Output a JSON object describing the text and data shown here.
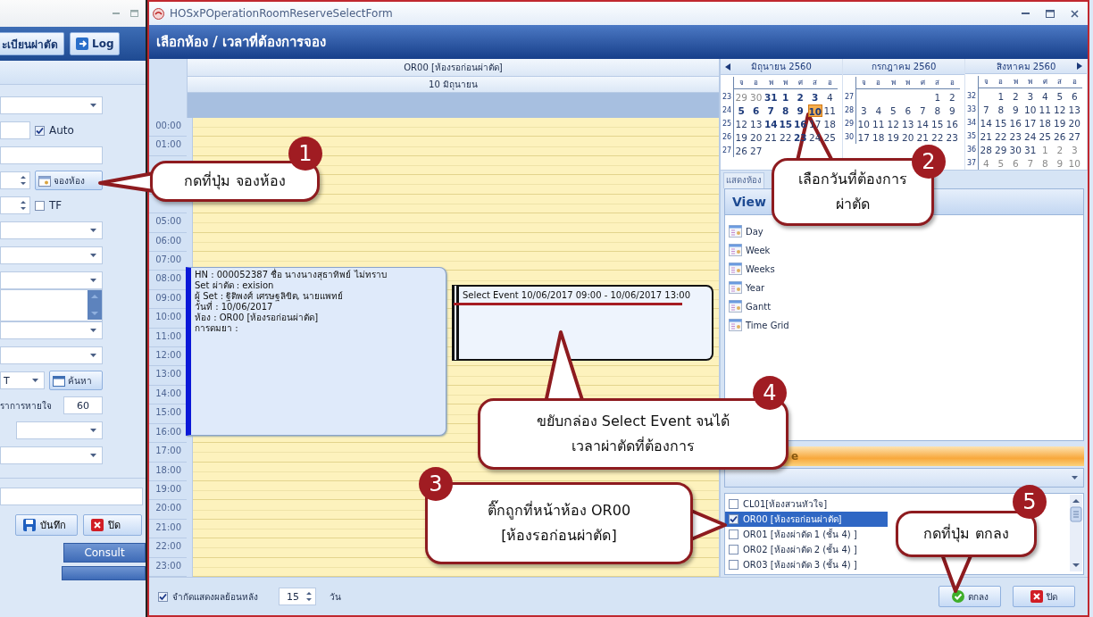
{
  "background_app": {
    "ribbon": [
      {
        "label": "ะเบียนผ่าตัด",
        "kind": "tab"
      },
      {
        "label": "Log",
        "kind": "logout"
      }
    ],
    "form": [
      {
        "kind": "dropdown"
      },
      {
        "kind": "text_check",
        "label": "Auto",
        "checked": true
      },
      {
        "kind": "text"
      },
      {
        "kind": "spin_button",
        "button": "จองห้อง"
      },
      {
        "kind": "spin_check",
        "label": "TF",
        "checked": false
      },
      {
        "kind": "dropdown"
      },
      {
        "kind": "dropdown"
      },
      {
        "kind": "dropdown"
      },
      {
        "kind": "textarea"
      },
      {
        "kind": "dropdown"
      },
      {
        "kind": "dropdown"
      },
      {
        "kind": "search",
        "value": "T",
        "button": "ค้นหา"
      },
      {
        "kind": "label_value",
        "label": "ราการหายใจ",
        "value": "60"
      },
      {
        "kind": "dropdown_short"
      },
      {
        "kind": "dropdown"
      }
    ],
    "actions": [
      {
        "label": "บันทึก",
        "kind": "save"
      },
      {
        "label": "ปิด",
        "kind": "close"
      }
    ],
    "side_buttons": [
      "Consult"
    ]
  },
  "window": {
    "title": "HOSxPOperationRoomReserveSelectForm"
  },
  "heading": "เลือกห้อง / เวลาที่ต้องการจอง",
  "scheduler": {
    "resource": "OR00 [ห้องรอก่อนผ่าตัด]",
    "date": "10 มิถุนายน",
    "hours": [
      "00:00",
      "01:00"
    ],
    "hours_late": [
      "05:00",
      "06:00",
      "07:00",
      "08:00",
      "09:00",
      "10:00",
      "11:00",
      "12:00",
      "13:00",
      "14:00",
      "15:00",
      "16:00",
      "17:00",
      "18:00",
      "19:00",
      "20:00",
      "21:00",
      "22:00",
      "23:00"
    ],
    "appointment": [
      "HN : 000052387 ชื่อ นางนางสุธาทิพย์ ไม่ทราบ",
      "Set ผ่าตัด : exision",
      "ผู้ Set : ฐิติพงศ์  เศรษฐลิขิต, นายแพทย์",
      "วันที่ : 10/06/2017",
      "ห้อง : OR00 [ห้องรอก่อนผ่าตัด]",
      "การดมยา :"
    ],
    "selection": "Select Event 10/06/2017 09:00 - 10/06/2017 13:00"
  },
  "calendar": {
    "months": [
      {
        "title": "มิถุนายน 2560",
        "weekdays": [
          "จ",
          "อ",
          "พ",
          "พ",
          "ศ",
          "ส",
          "อ"
        ],
        "weeks": [
          {
            "no": "23",
            "days": [
              {
                "d": "29",
                "kind": "muted",
                "selected": false
              },
              {
                "d": "30",
                "kind": "muted",
                "selected": false
              },
              {
                "d": "31",
                "kind": "bold",
                "selected": false
              },
              {
                "d": "1",
                "kind": "bold",
                "selected": false
              },
              {
                "d": "2",
                "kind": "bold",
                "selected": false
              },
              {
                "d": "3",
                "kind": "bold",
                "selected": false
              },
              {
                "d": "4",
                "kind": "plain",
                "selected": false
              }
            ]
          },
          {
            "no": "24",
            "days": [
              {
                "d": "5",
                "kind": "bold",
                "selected": false
              },
              {
                "d": "6",
                "kind": "bold",
                "selected": false
              },
              {
                "d": "7",
                "kind": "bold",
                "selected": false
              },
              {
                "d": "8",
                "kind": "bold",
                "selected": false
              },
              {
                "d": "9",
                "kind": "bold",
                "selected": false
              },
              {
                "d": "10",
                "kind": "bold",
                "selected": true
              },
              {
                "d": "11",
                "kind": "plain",
                "selected": false
              }
            ]
          },
          {
            "no": "25",
            "days": [
              {
                "d": "12",
                "kind": "plain",
                "selected": false
              },
              {
                "d": "13",
                "kind": "plain",
                "selected": false
              },
              {
                "d": "14",
                "kind": "bold",
                "selected": false
              },
              {
                "d": "15",
                "kind": "bold",
                "selected": false
              },
              {
                "d": "16",
                "kind": "bold",
                "selected": false
              },
              {
                "d": "17",
                "kind": "plain",
                "selected": false
              },
              {
                "d": "18",
                "kind": "plain",
                "selected": false
              }
            ]
          },
          {
            "no": "26",
            "days": [
              {
                "d": "19",
                "kind": "plain",
                "selected": false
              },
              {
                "d": "20",
                "kind": "plain",
                "selected": false
              },
              {
                "d": "21",
                "kind": "plain",
                "selected": false
              },
              {
                "d": "22",
                "kind": "plain",
                "selected": false
              },
              {
                "d": "23",
                "kind": "bold",
                "selected": false
              },
              {
                "d": "24",
                "kind": "plain",
                "selected": false
              },
              {
                "d": "25",
                "kind": "plain",
                "selected": false
              }
            ]
          },
          {
            "no": "27",
            "days": [
              {
                "d": "26",
                "kind": "plain",
                "selected": false
              },
              {
                "d": "27",
                "kind": "plain",
                "selected": false
              }
            ]
          }
        ]
      },
      {
        "title": "กรกฎาคม 2560",
        "weekdays": [
          "จ",
          "อ",
          "พ",
          "พ",
          "ศ",
          "ส",
          "อ"
        ],
        "weeks": [
          {
            "no": "27",
            "days": [
              {
                "d": "1",
                "kind": "plain",
                "selected": false
              },
              {
                "d": "2",
                "kind": "plain",
                "selected": false
              }
            ]
          },
          {
            "no": "28",
            "days": [
              {
                "d": "3",
                "kind": "plain",
                "selected": false
              },
              {
                "d": "4",
                "kind": "plain",
                "selected": false
              },
              {
                "d": "5",
                "kind": "plain",
                "selected": false
              },
              {
                "d": "6",
                "kind": "plain",
                "selected": false
              },
              {
                "d": "7",
                "kind": "plain",
                "selected": false
              },
              {
                "d": "8",
                "kind": "plain",
                "selected": false
              },
              {
                "d": "9",
                "kind": "plain",
                "selected": false
              }
            ]
          },
          {
            "no": "29",
            "days": [
              {
                "d": "10",
                "kind": "plain",
                "selected": false
              },
              {
                "d": "11",
                "kind": "plain",
                "selected": false
              },
              {
                "d": "12",
                "kind": "plain",
                "selected": false
              },
              {
                "d": "13",
                "kind": "plain",
                "selected": false
              },
              {
                "d": "14",
                "kind": "plain",
                "selected": false
              },
              {
                "d": "15",
                "kind": "plain",
                "selected": false
              },
              {
                "d": "16",
                "kind": "plain",
                "selected": false
              }
            ]
          },
          {
            "no": "30",
            "days": [
              {
                "d": "17",
                "kind": "plain",
                "selected": false
              },
              {
                "d": "18",
                "kind": "plain",
                "selected": false
              },
              {
                "d": "19",
                "kind": "plain",
                "selected": false
              },
              {
                "d": "20",
                "kind": "plain",
                "selected": false
              },
              {
                "d": "21",
                "kind": "plain",
                "selected": false
              },
              {
                "d": "22",
                "kind": "plain",
                "selected": false
              },
              {
                "d": "23",
                "kind": "plain",
                "selected": false
              }
            ]
          }
        ]
      },
      {
        "title": "สิงหาคม 2560",
        "weekdays": [
          "จ",
          "อ",
          "พ",
          "พ",
          "ศ",
          "ส",
          "อ"
        ],
        "weeks": [
          {
            "no": "32",
            "days": [
              {
                "d": "1",
                "kind": "plain",
                "selected": false
              },
              {
                "d": "2",
                "kind": "plain",
                "selected": false
              },
              {
                "d": "3",
                "kind": "plain",
                "selected": false
              },
              {
                "d": "4",
                "kind": "plain",
                "selected": false
              },
              {
                "d": "5",
                "kind": "plain",
                "selected": false
              },
              {
                "d": "6",
                "kind": "plain",
                "selected": false
              }
            ]
          },
          {
            "no": "33",
            "days": [
              {
                "d": "7",
                "kind": "plain",
                "selected": false
              },
              {
                "d": "8",
                "kind": "plain",
                "selected": false
              },
              {
                "d": "9",
                "kind": "plain",
                "selected": false
              },
              {
                "d": "10",
                "kind": "plain",
                "selected": false
              },
              {
                "d": "11",
                "kind": "plain",
                "selected": false
              },
              {
                "d": "12",
                "kind": "plain",
                "selected": false
              },
              {
                "d": "13",
                "kind": "plain",
                "selected": false
              }
            ]
          },
          {
            "no": "34",
            "days": [
              {
                "d": "14",
                "kind": "plain",
                "selected": false
              },
              {
                "d": "15",
                "kind": "plain",
                "selected": false
              },
              {
                "d": "16",
                "kind": "plain",
                "selected": false
              },
              {
                "d": "17",
                "kind": "plain",
                "selected": false
              },
              {
                "d": "18",
                "kind": "plain",
                "selected": false
              },
              {
                "d": "19",
                "kind": "plain",
                "selected": false
              },
              {
                "d": "20",
                "kind": "plain",
                "selected": false
              }
            ]
          },
          {
            "no": "35",
            "days": [
              {
                "d": "21",
                "kind": "plain",
                "selected": false
              },
              {
                "d": "22",
                "kind": "plain",
                "selected": false
              },
              {
                "d": "23",
                "kind": "plain",
                "selected": false
              },
              {
                "d": "24",
                "kind": "plain",
                "selected": false
              },
              {
                "d": "25",
                "kind": "plain",
                "selected": false
              },
              {
                "d": "26",
                "kind": "plain",
                "selected": false
              },
              {
                "d": "27",
                "kind": "plain",
                "selected": false
              }
            ]
          },
          {
            "no": "36",
            "days": [
              {
                "d": "28",
                "kind": "plain",
                "selected": false
              },
              {
                "d": "29",
                "kind": "plain",
                "selected": false
              },
              {
                "d": "30",
                "kind": "plain",
                "selected": false
              },
              {
                "d": "31",
                "kind": "plain",
                "selected": false
              },
              {
                "d": "1",
                "kind": "muted",
                "selected": false
              },
              {
                "d": "2",
                "kind": "muted",
                "selected": false
              },
              {
                "d": "3",
                "kind": "muted",
                "selected": false
              }
            ]
          },
          {
            "no": "37",
            "days": [
              {
                "d": "4",
                "kind": "muted",
                "selected": false
              },
              {
                "d": "5",
                "kind": "muted",
                "selected": false
              },
              {
                "d": "6",
                "kind": "muted",
                "selected": false
              },
              {
                "d": "7",
                "kind": "muted",
                "selected": false
              },
              {
                "d": "8",
                "kind": "muted",
                "selected": false
              },
              {
                "d": "9",
                "kind": "muted",
                "selected": false
              },
              {
                "d": "10",
                "kind": "muted",
                "selected": false
              }
            ]
          }
        ]
      }
    ]
  },
  "side_panel": {
    "tab": "แสดงห้อง",
    "view_header": "View",
    "views": [
      "Day",
      "Week",
      "Weeks",
      "Year",
      "Gantt",
      "Time Grid"
    ],
    "group_bar": "e",
    "rooms": [
      {
        "label": "CL01[ห้องสวนหัวใจ]",
        "checked": false,
        "selected": false
      },
      {
        "label": "OR00 [ห้องรอก่อนผ่าตัด]",
        "checked": true,
        "selected": true
      },
      {
        "label": "OR01 [ห้องผ่าตัด 1 (ชั้น 4) ]",
        "checked": false,
        "selected": false
      },
      {
        "label": "OR02 [ห้องผ่าตัด 2 (ชั้น 4) ]",
        "checked": false,
        "selected": false
      },
      {
        "label": "OR03 [ห้องผ่าตัด 3 (ชั้น 4) ]",
        "checked": false,
        "selected": false
      }
    ]
  },
  "footer": {
    "limit_label": "จำกัดแสดงผลย้อนหลัง",
    "limit_checked": true,
    "days": "15",
    "unit": "วัน",
    "buttons": [
      {
        "label": "ตกลง",
        "kind": "ok"
      },
      {
        "label": "ปิด",
        "kind": "close"
      }
    ]
  },
  "callouts": [
    {
      "number": "1",
      "text": "กดที่ปุ่ม จองห้อง"
    },
    {
      "number": "2",
      "text": "เลือกวันที่ต้องการ\nผ่าตัด"
    },
    {
      "number": "3",
      "text": "ติ๊กถูกที่หน้าห้อง OR00\n[ห้องรอก่อนผ่าตัด]"
    },
    {
      "number": "4",
      "text": "ขยับกล่อง Select Event จนได้\nเวลาผ่าตัดที่ต้องการ"
    },
    {
      "number": "5",
      "text": "กดที่ปุ่ม ตกลง"
    }
  ]
}
